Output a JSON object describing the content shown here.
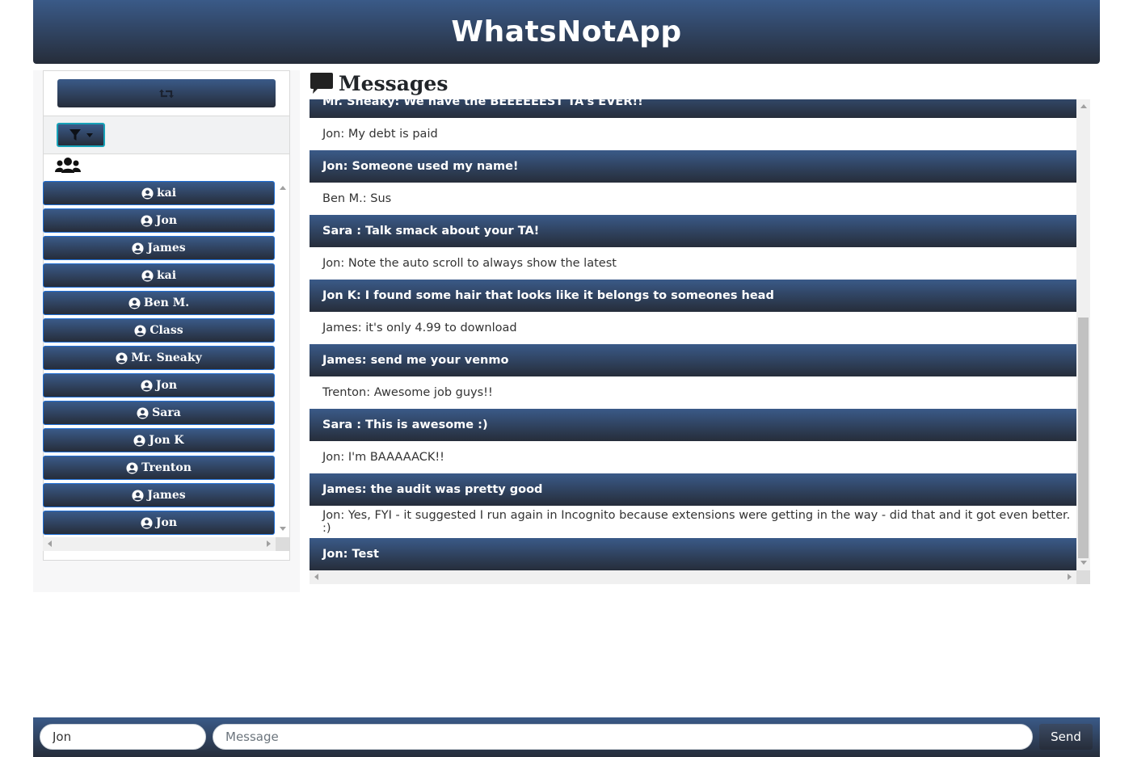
{
  "app": {
    "title": "WhatsNotApp"
  },
  "sidebar": {
    "refresh_icon": "retweet-icon",
    "filter_icon": "filter-icon",
    "group_icon": "users-icon",
    "users": [
      {
        "label": "kai"
      },
      {
        "label": "Jon"
      },
      {
        "label": "James"
      },
      {
        "label": "kai"
      },
      {
        "label": "Ben M."
      },
      {
        "label": "Class"
      },
      {
        "label": "Mr. Sneaky"
      },
      {
        "label": "Jon"
      },
      {
        "label": "Sara"
      },
      {
        "label": "Jon K"
      },
      {
        "label": "Trenton"
      },
      {
        "label": "James"
      },
      {
        "label": "Jon"
      }
    ]
  },
  "messages": {
    "title": "Messages",
    "items": [
      {
        "text": "Mr. Sneaky: We have the BEEEEEEST TA's EVER!!",
        "style": "dark"
      },
      {
        "text": "Jon: My debt is paid",
        "style": "light"
      },
      {
        "text": "Jon: Someone used my name!",
        "style": "dark"
      },
      {
        "text": "Ben M.: Sus",
        "style": "light"
      },
      {
        "text": "Sara : Talk smack about your TA!",
        "style": "dark"
      },
      {
        "text": "Jon: Note the auto scroll to always show the latest",
        "style": "light"
      },
      {
        "text": "Jon K: I found some hair that looks like it belongs to someones head",
        "style": "dark"
      },
      {
        "text": "James: it's only 4.99 to download",
        "style": "light"
      },
      {
        "text": "James: send me your venmo",
        "style": "dark"
      },
      {
        "text": "Trenton: Awesome job guys!!",
        "style": "light"
      },
      {
        "text": "Sara : This is awesome :)",
        "style": "dark"
      },
      {
        "text": "Jon: I'm BAAAAACK!!",
        "style": "light"
      },
      {
        "text": "James: the audit was pretty good",
        "style": "dark"
      },
      {
        "text": "Jon: Yes, FYI - it suggested I run again in Incognito because extensions were getting in the way - did that and it got even better. :)",
        "style": "light"
      },
      {
        "text": "Jon: Test",
        "style": "dark"
      }
    ]
  },
  "footer": {
    "username_value": "Jon",
    "message_placeholder": "Message",
    "send_label": "Send"
  },
  "colors": {
    "brand_top": "#3a5a88",
    "brand_bottom": "#262d3a",
    "filter_border": "#17a2b8",
    "user_border": "#1f6fd6"
  }
}
